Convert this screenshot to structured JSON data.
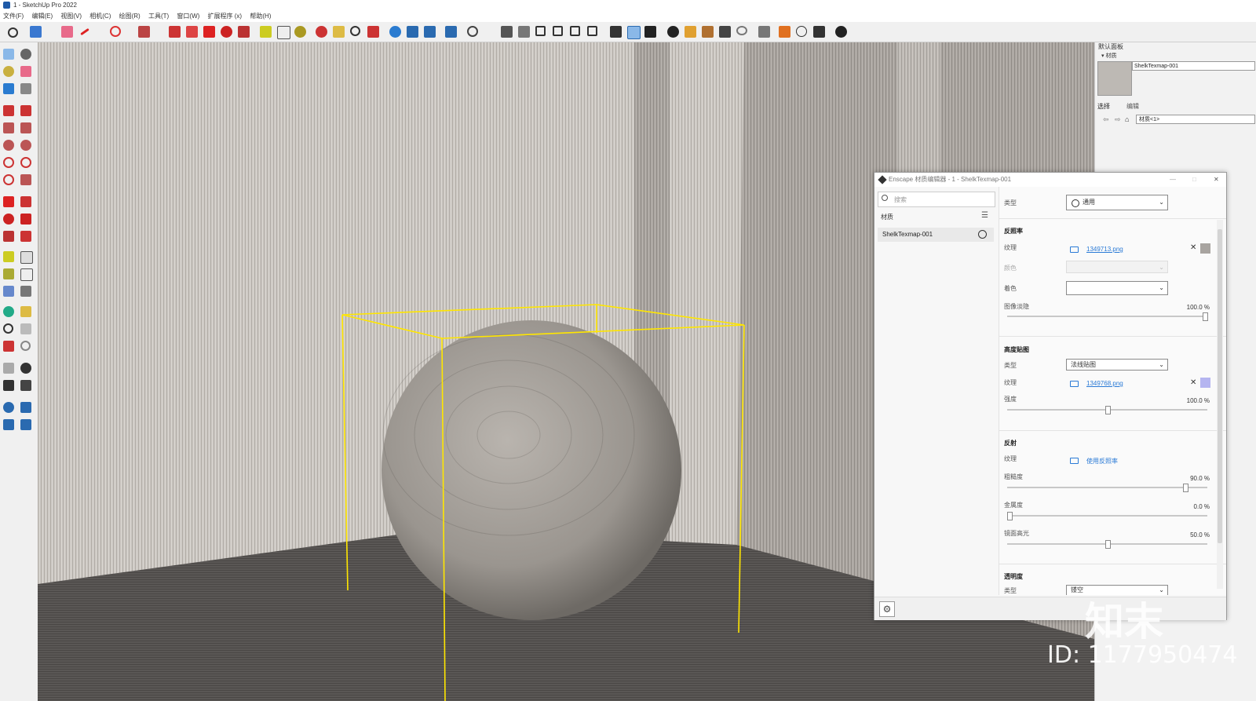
{
  "window": {
    "title": "1 - SketchUp Pro 2022"
  },
  "menubar": [
    "文件(F)",
    "编辑(E)",
    "视图(V)",
    "相机(C)",
    "绘图(R)",
    "工具(T)",
    "窗口(W)",
    "扩展程序 (x)",
    "帮助(H)"
  ],
  "default_tray": {
    "title": "默认面板",
    "section": "▾ 材质",
    "material_name": "ShelkTexmap-001",
    "tabs": [
      "选择",
      "编辑"
    ],
    "dropdown_value": "材质<1>"
  },
  "enscape": {
    "title": "Enscape 材质编辑器 - 1 - ShelkTexmap-001",
    "search_placeholder": "搜索",
    "materials_header": "材质",
    "materials": [
      "ShelkTexmap-001"
    ],
    "type_label": "类型",
    "type_value": "通用",
    "albedo": {
      "header": "反照率",
      "texture_label": "纹理",
      "texture_file": "1349713.png",
      "color_label": "颜色",
      "tint_label": "着色",
      "fade_label": "图像淡隐",
      "fade_value": "100.0 %",
      "fade_fraction": 1.0
    },
    "height_map": {
      "header": "高度贴图",
      "type_label": "类型",
      "type_value": "法线贴图",
      "texture_label": "纹理",
      "texture_file": "1349768.png",
      "strength_label": "强度",
      "strength_value": "100.0 %",
      "strength_fraction": 0.5
    },
    "reflection": {
      "header": "反射",
      "texture_label": "纹理",
      "texture_value": "使用反照率",
      "roughness_label": "粗糙度",
      "roughness_value": "90.0 %",
      "roughness_fraction": 0.9,
      "metallic_label": "金属度",
      "metallic_value": "0.0 %",
      "metallic_fraction": 0.0,
      "specular_label": "镜面高光",
      "specular_value": "50.0 %",
      "specular_fraction": 0.5
    },
    "transparency": {
      "header": "透明度",
      "type_label": "类型",
      "type_value": "镂空"
    }
  },
  "watermark": {
    "logo": "知末",
    "id": "ID: 1177950474"
  },
  "colors": {
    "selection": "#ffe600",
    "link": "#2a7ad6",
    "albedo_swatch": "#a8a4a0",
    "normal_swatch": "#b5b5f0"
  }
}
